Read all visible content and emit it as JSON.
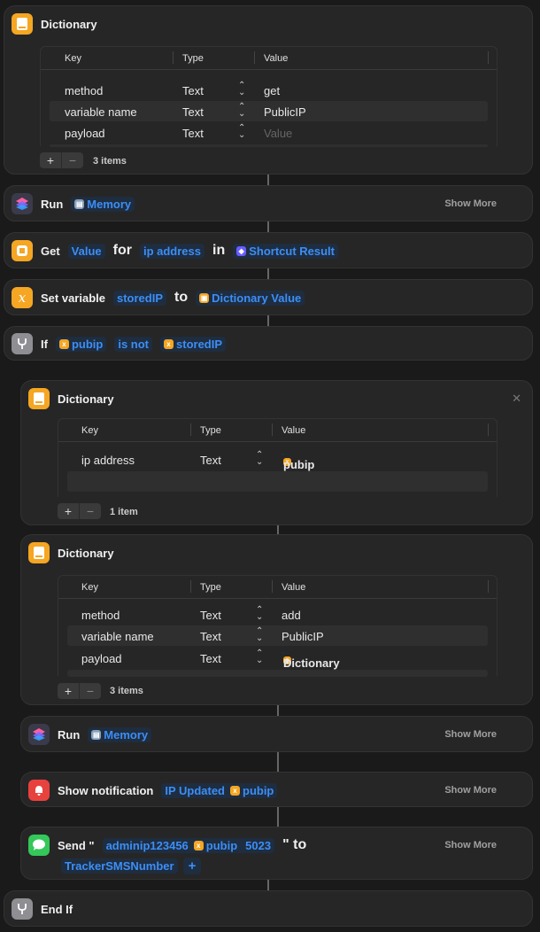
{
  "dict1": {
    "title": "Dictionary",
    "headers": {
      "key": "Key",
      "type": "Type",
      "value": "Value"
    },
    "rows": [
      {
        "key": "method",
        "type": "Text",
        "value": "get"
      },
      {
        "key": "variable name",
        "type": "Text",
        "value": "PublicIP"
      },
      {
        "key": "payload",
        "type": "Text",
        "value_placeholder": "Value"
      }
    ],
    "count": "3 items"
  },
  "run1": {
    "label": "Run",
    "shortcut": "Memory",
    "show_more": "Show More"
  },
  "get": {
    "label": "Get",
    "what": "Value",
    "for": "for",
    "key": "ip address",
    "in": "in",
    "source": "Shortcut Result"
  },
  "setvar": {
    "label": "Set variable",
    "name": "storedIP",
    "to": "to",
    "value": "Dictionary Value"
  },
  "if": {
    "label": "If",
    "var": "pubip",
    "cond": "is not",
    "target": "storedIP"
  },
  "dict2": {
    "title": "Dictionary",
    "headers": {
      "key": "Key",
      "type": "Type",
      "value": "Value"
    },
    "rows": [
      {
        "key": "ip address",
        "type": "Text",
        "value_token": "pubip"
      }
    ],
    "count": "1 item"
  },
  "dict3": {
    "title": "Dictionary",
    "headers": {
      "key": "Key",
      "type": "Type",
      "value": "Value"
    },
    "rows": [
      {
        "key": "method",
        "type": "Text",
        "value": "add"
      },
      {
        "key": "variable name",
        "type": "Text",
        "value": "PublicIP"
      },
      {
        "key": "payload",
        "type": "Text",
        "value_token": "Dictionary"
      }
    ],
    "count": "3 items"
  },
  "run2": {
    "label": "Run",
    "shortcut": "Memory",
    "show_more": "Show More"
  },
  "notify": {
    "label": "Show notification",
    "text": "IP Updated",
    "var": "pubip",
    "show_more": "Show More"
  },
  "send": {
    "label": "Send \"",
    "msg": "adminip123456",
    "var": "pubip",
    "num": "5023",
    "to": "\" to",
    "recipient": "TrackerSMSNumber",
    "plus": "+",
    "show_more": "Show More"
  },
  "endif": {
    "label": "End If"
  },
  "colors": {
    "orange": "#f5a623",
    "blue": "#3d8ef5",
    "red": "#e8423f",
    "green": "#34c759",
    "gray": "#8e8e93"
  }
}
